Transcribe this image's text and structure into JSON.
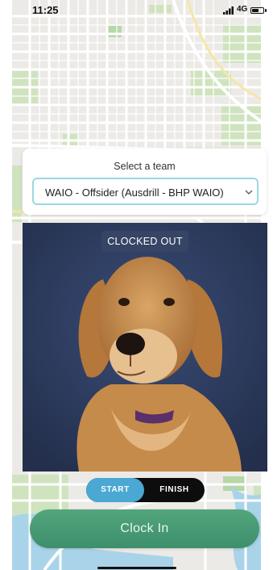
{
  "status_bar": {
    "time": "11:25",
    "network": "4G",
    "battery_level": 0.6
  },
  "team_selector": {
    "title": "Select a team",
    "selected_team": "WAIO - Offsider (Ausdrill - BHP WAIO)"
  },
  "clock_status": "CLOCKED OUT",
  "shift_toggle": {
    "start_label": "START",
    "finish_label": "FINISH",
    "active": "START"
  },
  "clock_button_label": "Clock In",
  "colors": {
    "accent_blue": "#4aa8d2",
    "clock_green": "#4a9d76",
    "select_border": "#9bd7e3"
  }
}
